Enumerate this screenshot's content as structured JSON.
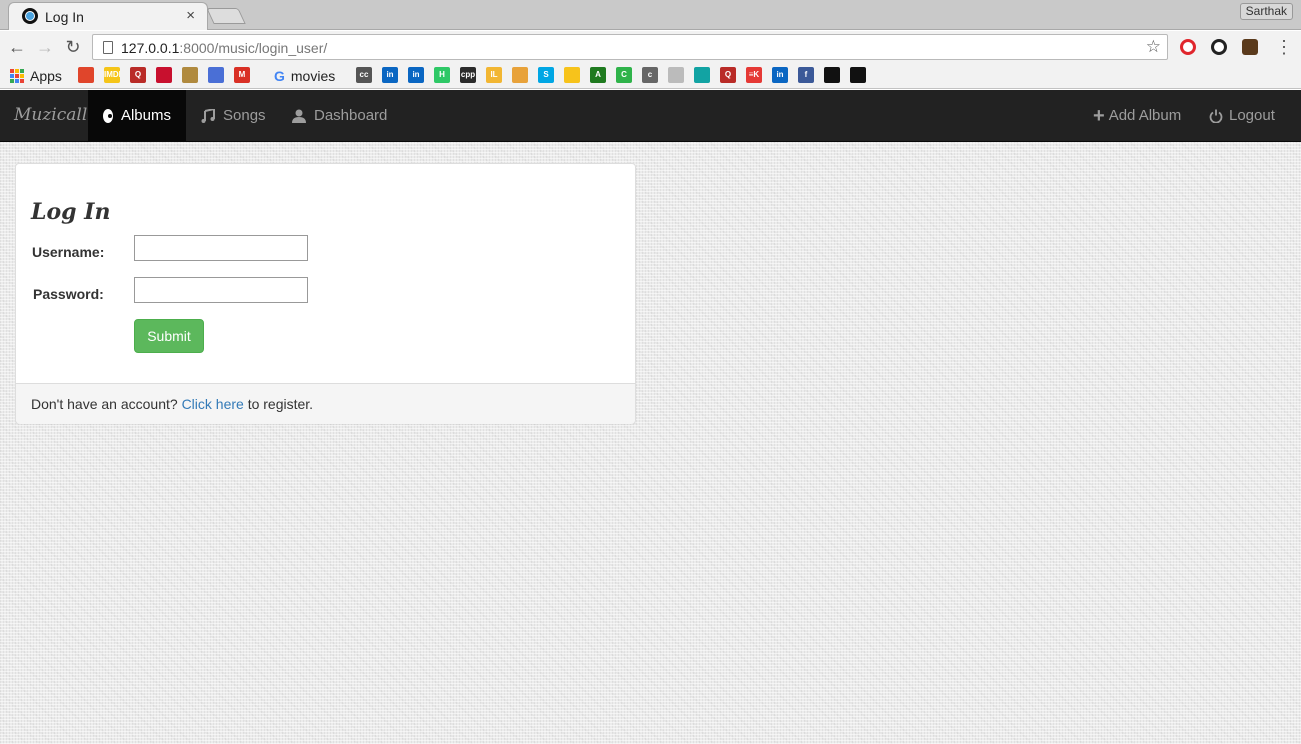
{
  "browser": {
    "tab_title": "Log In",
    "tab_close": "×",
    "profile_name": "Sarthak",
    "url_host": "127.0.0.1",
    "url_rest": ":8000/music/login_user/",
    "back_icon": "←",
    "forward_icon": "→",
    "reload_icon": "↻",
    "star_icon": "☆",
    "menu_icon": "⋮"
  },
  "bookmarks": {
    "apps_label": "Apps",
    "movies_label": "movies",
    "google_g": "G",
    "items": [
      {
        "name": "bookmark-icon-1",
        "color": "#e0452b",
        "text": ""
      },
      {
        "name": "imdb-icon",
        "color": "#f5c518",
        "text": "IMDb"
      },
      {
        "name": "quora-icon",
        "color": "#b92b27",
        "text": "Q"
      },
      {
        "name": "bookmark-icon-4",
        "color": "#c8102e",
        "text": ""
      },
      {
        "name": "bookmark-icon-5",
        "color": "#b08a3e",
        "text": ""
      },
      {
        "name": "bookmark-icon-6",
        "color": "#4a6fd6",
        "text": ""
      },
      {
        "name": "gmail-icon",
        "color": "#d93025",
        "text": "M"
      }
    ],
    "items_right": [
      {
        "name": "cc-icon",
        "color": "#555555",
        "text": "cc"
      },
      {
        "name": "linkedin-icon-1",
        "color": "#0a66c2",
        "text": "in"
      },
      {
        "name": "linkedin-icon-2",
        "color": "#0a66c2",
        "text": "in"
      },
      {
        "name": "hackerrank-icon",
        "color": "#2ec866",
        "text": "H"
      },
      {
        "name": "cpp-icon",
        "color": "#2b2b2b",
        "text": "cpp"
      },
      {
        "name": "bookmark-icon-13",
        "color": "#f2b632",
        "text": "IL"
      },
      {
        "name": "bookmark-icon-14",
        "color": "#e8a23a",
        "text": ""
      },
      {
        "name": "bookmark-icon-15",
        "color": "#00a6e4",
        "text": "S"
      },
      {
        "name": "bookmark-icon-16",
        "color": "#f7c31b",
        "text": ""
      },
      {
        "name": "bookmark-icon-17",
        "color": "#1f7a1f",
        "text": "A"
      },
      {
        "name": "bookmark-icon-18",
        "color": "#2fb34a",
        "text": "C"
      },
      {
        "name": "bookmark-icon-19",
        "color": "#666666",
        "text": "c"
      },
      {
        "name": "page-icon-bm",
        "color": "#bbbbbb",
        "text": ""
      },
      {
        "name": "bookmark-icon-21",
        "color": "#12a3a3",
        "text": ""
      },
      {
        "name": "quora-icon-2",
        "color": "#b92b27",
        "text": "Q"
      },
      {
        "name": "bookmark-icon-23",
        "color": "#e53935",
        "text": "≡K"
      },
      {
        "name": "linkedin-icon-3",
        "color": "#0a66c2",
        "text": "in"
      },
      {
        "name": "facebook-icon",
        "color": "#3b5998",
        "text": "f"
      },
      {
        "name": "bookmark-icon-26",
        "color": "#111111",
        "text": ""
      },
      {
        "name": "github-icon",
        "color": "#111111",
        "text": ""
      }
    ]
  },
  "navbar": {
    "brand": "Muzicall",
    "albums": "Albums",
    "songs": "Songs",
    "dashboard": "Dashboard",
    "add_album": "Add Album",
    "logout": "Logout"
  },
  "login": {
    "title": "Log In",
    "username_label": "Username:",
    "username_value": "",
    "password_label": "Password:",
    "password_value": "",
    "submit_label": "Submit",
    "footer_prefix": "Don't have an account?",
    "footer_link": "Click here",
    "footer_suffix": "to register."
  },
  "colors": {
    "navbar_bg": "#222222",
    "success": "#5cb85c",
    "link": "#337ab7"
  }
}
